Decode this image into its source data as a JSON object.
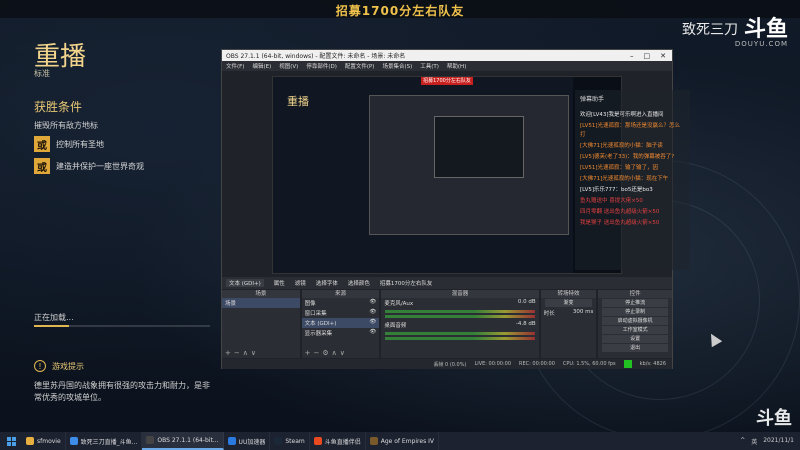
{
  "stream": {
    "top_title": "招募1700分左右队友",
    "streamer": "致死三刀",
    "logo": "斗鱼",
    "logo_sub": "DOUYU.COM"
  },
  "game_panel": {
    "heading": "重播",
    "subheading": "标准",
    "win_title": "获胜条件",
    "win_desc": "摧毁所有敌方地标",
    "options": [
      {
        "tag": "或",
        "text": "控制所有圣地"
      },
      {
        "tag": "或",
        "text": "建造并保护一座世界奇观"
      }
    ],
    "loading": "正在加载...",
    "loading_progress": 0.2,
    "tip_title": "游戏提示",
    "tip_text": "德里苏丹国的战象拥有很强的攻击力和耐力，是非常优秀的攻城单位。"
  },
  "obs": {
    "title": "OBS 27.1.1 (64-bit, windows) - 配置文件: 未命名 - 场景: 未命名",
    "menu": [
      "文件(F)",
      "编辑(E)",
      "视图(V)",
      "停靠部件(D)",
      "配置文件(P)",
      "场景集合(S)",
      "工具(T)",
      "帮助(H)"
    ],
    "preview_banner": "招募1700分左右队友",
    "toolbar": [
      "文本 (GDI+)",
      "属性",
      "滤镜",
      "选择字体",
      "选择颜色"
    ],
    "toolbar_text": "招募1700分左右队友",
    "scenes_header": "场景",
    "scenes": [
      "场景"
    ],
    "sources_header": "来源",
    "sources": [
      "图像",
      "窗口采集",
      "文本 (GDI+)",
      "显示器采集"
    ],
    "mixer_header": "混音器",
    "mixer": [
      {
        "name": "麦克风/Aux",
        "db": "0.0 dB"
      },
      {
        "name": "桌面音频",
        "db": "-4.8 dB"
      }
    ],
    "transitions_header": "转场特效",
    "transition_value": "渐变",
    "duration_label": "时长",
    "duration_value": "300 ms",
    "controls_header": "控件",
    "controls": [
      "停止推流",
      "停止录制",
      "启动虚拟摄像机",
      "工作室模式",
      "设置",
      "退出"
    ],
    "status": [
      "丢帧 0 (0.0%)",
      "LIVE: 00:00:00",
      "REC: 00:00:00",
      "CPU: 1.5%, 60.00 fps",
      "kb/s: 4826"
    ]
  },
  "chat": {
    "title": "弹幕助手",
    "messages": [
      {
        "text": "欢迎[LV43]我是可乐啊进入直播间",
        "color": "white"
      },
      {
        "text": "[LV51]光速孤寂：那场还是没赢么？怎么打",
        "color": "orange"
      },
      {
        "text": "[大佛71]光速孤寂的小猫：脑子读",
        "color": "orange"
      },
      {
        "text": "[LV5]德芙(老了33)：我的弹幕被吞了?",
        "color": "orange"
      },
      {
        "text": "[LV51]光速孤寂：输了输了，因",
        "color": "orange"
      },
      {
        "text": "[大佛71]光速孤寂的小猫：现在下午",
        "color": "orange"
      },
      {
        "text": "[LV5]乐乐777：bo5还是bo3",
        "color": "white"
      },
      {
        "text": "鱼丸赠送中 喜提大佬×50",
        "color": "red"
      },
      {
        "text": "四月零翻 送出鱼丸超级火箭×50",
        "color": "red"
      },
      {
        "text": "我是猴子 送出鱼丸超级火箭×50",
        "color": "red"
      }
    ]
  },
  "watermark": "斗鱼",
  "taskbar": {
    "items": [
      {
        "label": "sfmovie",
        "color": "#e8b040"
      },
      {
        "label": "致死三刀直播_斗鱼...",
        "color": "#3c8ce8"
      },
      {
        "label": "OBS 27.1.1 (64-bit...",
        "color": "#444"
      },
      {
        "label": "UU加速器",
        "color": "#2a7ae0"
      },
      {
        "label": "Steam",
        "color": "#1b2838"
      },
      {
        "label": "斗鱼直播伴侣",
        "color": "#e84a20"
      },
      {
        "label": "Age of Empires IV",
        "color": "#7a5a2a"
      }
    ],
    "tray": [
      "^",
      "英",
      "2021/11/1"
    ]
  }
}
